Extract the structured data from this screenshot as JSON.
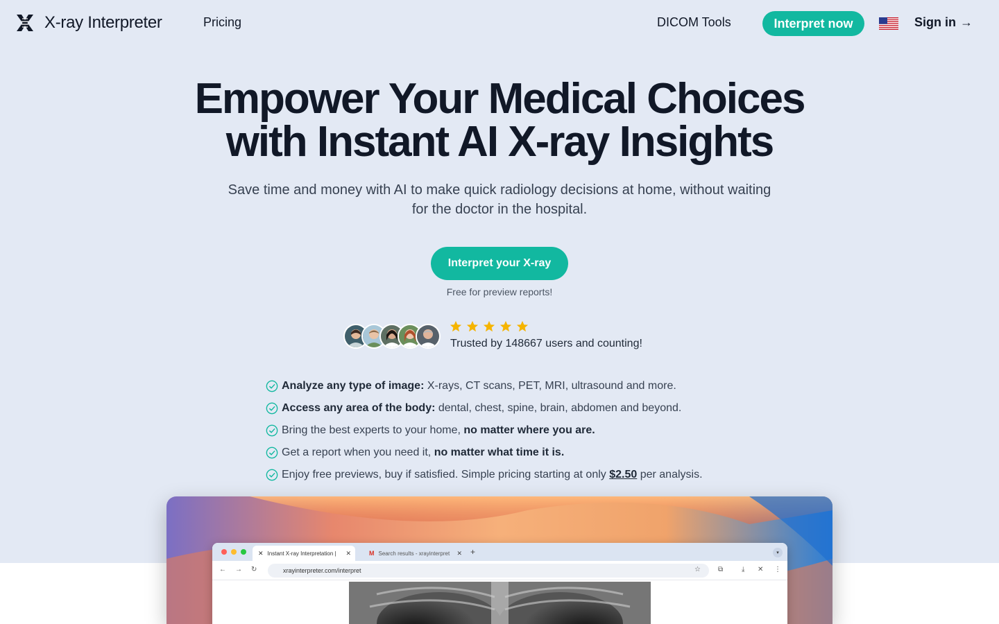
{
  "nav": {
    "brand": "X-ray Interpreter",
    "pricing": "Pricing",
    "dicom_tools": "DICOM Tools",
    "cta": "Interpret now",
    "sign_in": "Sign in",
    "sign_in_arrow": "→",
    "language_flag": "us-flag-icon"
  },
  "hero": {
    "headline_line1": "Empower Your Medical Choices",
    "headline_line2": "with Instant AI X-ray Insights",
    "subhead": "Save time and money with AI to make quick radiology decisions at home, without waiting for the doctor in the hospital.",
    "button": "Interpret your X-ray",
    "note": "Free for preview reports!"
  },
  "social_proof": {
    "rating_stars": 5,
    "trusted_text": "Trusted by 148667 users and counting!",
    "avatars": 5
  },
  "features": [
    {
      "bold": "Analyze any type of image:",
      "text": " X-rays, CT scans, PET, MRI, ultrasound and more."
    },
    {
      "bold": "Access any area of the body:",
      "text": " dental, chest, spine, brain, abdomen and beyond."
    },
    {
      "text": "Bring the best experts to your home, ",
      "bold_end": "no matter where you are."
    },
    {
      "text": "Get a report when you need it, ",
      "bold_end": "no matter what time it is."
    },
    {
      "text": "Enjoy free previews, buy if satisfied. Simple pricing starting at only ",
      "link": "$2.50",
      "text_end": " per analysis."
    }
  ],
  "browser_mock": {
    "tab1": "Instant X-ray Interpretation |",
    "tab2": "Search results - xrayinterpret",
    "url": "xrayinterpreter.com/interpret"
  },
  "colors": {
    "accent": "#12b8a0",
    "hero_bg": "#e3e9f4",
    "star": "#f5b400",
    "text_dark": "#111827"
  }
}
